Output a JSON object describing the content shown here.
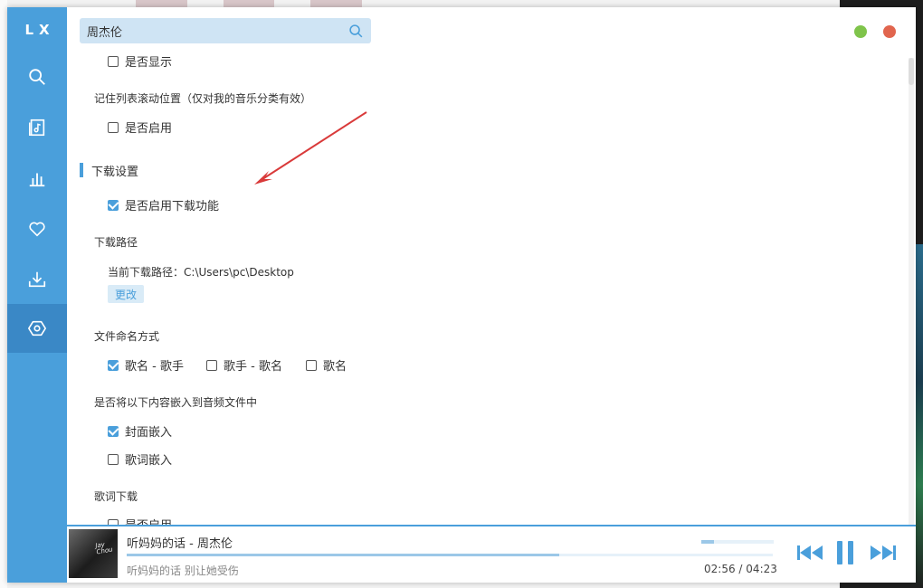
{
  "app": {
    "logo": "LX"
  },
  "search": {
    "value": "周杰伦"
  },
  "colors": {
    "accent": "#4a9fdb",
    "minimize": "#7fc44b",
    "close": "#e1654e"
  },
  "sidebar": {
    "items": [
      {
        "icon": "search-icon"
      },
      {
        "icon": "song-list-icon"
      },
      {
        "icon": "leaderboard-icon"
      },
      {
        "icon": "heart-icon"
      },
      {
        "icon": "download-icon"
      },
      {
        "icon": "settings-icon",
        "active": true
      }
    ]
  },
  "settings": {
    "show_option": {
      "label": "是否显示",
      "checked": false
    },
    "remember_scroll": {
      "title": "记住列表滚动位置（仅对我的音乐分类有效）",
      "option": {
        "label": "是否启用",
        "checked": false
      }
    },
    "download_section_title": "下载设置",
    "enable_download": {
      "label": "是否启用下载功能",
      "checked": true
    },
    "download_path": {
      "title": "下载路径",
      "current_prefix": "当前下载路径：",
      "current_value": "C:\\Users\\pc\\Desktop",
      "change_label": "更改"
    },
    "file_naming": {
      "title": "文件命名方式",
      "options": [
        {
          "label": "歌名 - 歌手",
          "checked": true
        },
        {
          "label": "歌手 - 歌名",
          "checked": false
        },
        {
          "label": "歌名",
          "checked": false
        }
      ]
    },
    "embed": {
      "title": "是否将以下内容嵌入到音频文件中",
      "options": [
        {
          "label": "封面嵌入",
          "checked": true
        },
        {
          "label": "歌词嵌入",
          "checked": false
        }
      ]
    },
    "lyric_download": {
      "title": "歌词下载",
      "option": {
        "label": "是否启用",
        "checked": false
      }
    }
  },
  "player": {
    "title": "听妈妈的话 - 周杰伦",
    "lyric": "听妈妈的话 别让她受伤",
    "current_time": "02:56",
    "separator": "/",
    "total_time": "04:23",
    "progress": 0.67,
    "buffer": 0.18
  }
}
